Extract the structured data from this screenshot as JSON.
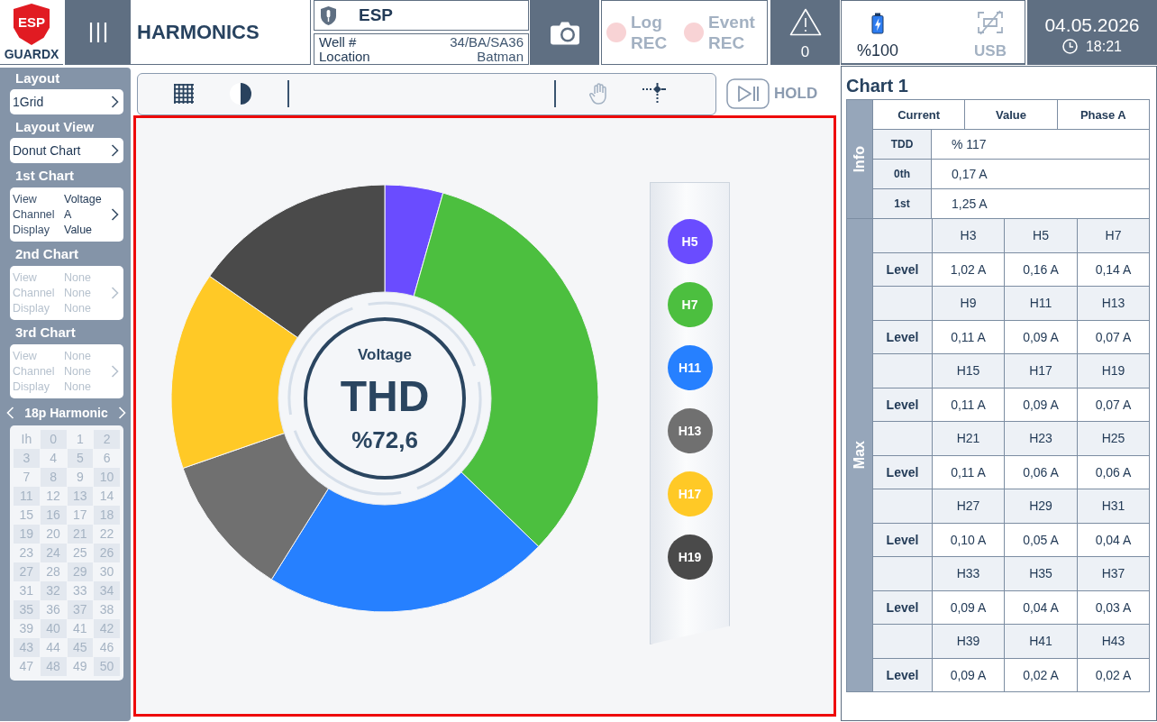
{
  "top_bar": {
    "logo": {
      "badge": "ESP",
      "name": "GUARDX"
    },
    "title": "HARMONICS",
    "device": {
      "name": "ESP",
      "fields": [
        {
          "label": "Well #",
          "value": "34/BA/SA36"
        },
        {
          "label": "Location",
          "value": "Batman"
        }
      ]
    },
    "recorders": [
      {
        "label": "Log REC",
        "recording": false
      },
      {
        "label": "Event REC",
        "recording": false
      }
    ],
    "alerts": {
      "count": "0"
    },
    "battery": {
      "reading": "%100"
    },
    "usb": {
      "label": "USB",
      "connected": false
    },
    "clock": {
      "date": "04.05.2026",
      "time": "18:21"
    }
  },
  "sidebar": {
    "selects": [
      {
        "heading": "Layout",
        "value": "1Grid"
      },
      {
        "heading": "Layout View",
        "value": "Donut Chart"
      }
    ],
    "charts": [
      {
        "heading": "1st Chart",
        "disabled": false,
        "rows": [
          {
            "label": "View",
            "value": "Voltage"
          },
          {
            "label": "Channel",
            "value": "A"
          },
          {
            "label": "Display",
            "value": "Value"
          }
        ]
      },
      {
        "heading": "2nd Chart",
        "disabled": true,
        "rows": [
          {
            "label": "View",
            "value": "None"
          },
          {
            "label": "Channel",
            "value": "None"
          },
          {
            "label": "Display",
            "value": "None"
          }
        ]
      },
      {
        "heading": "3rd Chart",
        "disabled": true,
        "rows": [
          {
            "label": "View",
            "value": "None"
          },
          {
            "label": "Channel",
            "value": "None"
          },
          {
            "label": "Display",
            "value": "None"
          }
        ]
      }
    ],
    "harmonics": {
      "title": "18p Harmonic",
      "disabled": true,
      "cells": [
        "Ih",
        "0",
        "1",
        "2",
        "3",
        "4",
        "5",
        "6",
        "7",
        "8",
        "9",
        "10",
        "11",
        "12",
        "13",
        "14",
        "15",
        "16",
        "17",
        "18",
        "19",
        "20",
        "21",
        "22",
        "23",
        "24",
        "25",
        "26",
        "27",
        "28",
        "29",
        "30",
        "31",
        "32",
        "33",
        "34",
        "35",
        "36",
        "37",
        "38",
        "39",
        "40",
        "41",
        "42",
        "43",
        "44",
        "45",
        "46",
        "47",
        "48",
        "49",
        "50"
      ]
    }
  },
  "main": {
    "toolbar": {
      "left": [
        {
          "kind": "grid",
          "disabled": false
        },
        {
          "kind": "contrast",
          "disabled": false
        }
      ],
      "right": [
        {
          "kind": "hand",
          "disabled": true
        },
        {
          "kind": "crosshair",
          "disabled": false
        }
      ]
    },
    "hold": {
      "label": "HOLD",
      "on": false
    },
    "chart_panel": {
      "selected": true,
      "center": {
        "caption": "Voltage",
        "metric": "THD",
        "reading": "%72,6"
      },
      "legend": [
        {
          "color": "#6a4cff"
        },
        {
          "color": "#4cbf3f"
        },
        {
          "color": "#2680ff"
        },
        {
          "color": "#707070"
        },
        {
          "color": "#ffc926"
        },
        {
          "color": "#4a4a4a"
        }
      ],
      "chart_data": {
        "type": "donut",
        "categories": [
          "H5",
          "H7",
          "H11",
          "H13",
          "H17",
          "H19"
        ],
        "values": [
          4.4,
          32.8,
          21.7,
          10.8,
          15.0,
          15.3
        ]
      }
    }
  },
  "details": {
    "title": "Chart 1",
    "info": {
      "label": "Info",
      "header": [
        "Current",
        "Value",
        "Phase A"
      ],
      "rows": [
        {
          "label": "TDD",
          "value": "% 117"
        },
        {
          "label": "0th",
          "value": "0,17 A"
        },
        {
          "label": "1st",
          "value": "1,25 A"
        }
      ]
    },
    "max": {
      "label": "Max",
      "groups": [
        {
          "label": "Level",
          "harmonics": [
            "H3",
            "H5",
            "H7"
          ],
          "values": [
            "1,02 A",
            "0,16 A",
            "0,14 A"
          ]
        },
        {
          "label": "Level",
          "harmonics": [
            "H9",
            "H11",
            "H13"
          ],
          "values": [
            "0,11 A",
            "0,09 A",
            "0,07 A"
          ]
        },
        {
          "label": "Level",
          "harmonics": [
            "H15",
            "H17",
            "H19"
          ],
          "values": [
            "0,11 A",
            "0,09 A",
            "0,07 A"
          ]
        },
        {
          "label": "Level",
          "harmonics": [
            "H21",
            "H23",
            "H25"
          ],
          "values": [
            "0,11 A",
            "0,06 A",
            "0,06 A"
          ]
        },
        {
          "label": "Level",
          "harmonics": [
            "H27",
            "H29",
            "H31"
          ],
          "values": [
            "0,10 A",
            "0,05 A",
            "0,04 A"
          ]
        },
        {
          "label": "Level",
          "harmonics": [
            "H33",
            "H35",
            "H37"
          ],
          "values": [
            "0,09 A",
            "0,04 A",
            "0,03 A"
          ]
        },
        {
          "label": "Level",
          "harmonics": [
            "H39",
            "H41",
            "H43"
          ],
          "values": [
            "0,09 A",
            "0,02 A",
            "0,02 A"
          ]
        }
      ]
    }
  }
}
